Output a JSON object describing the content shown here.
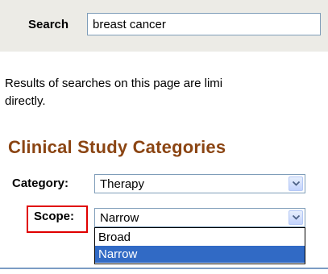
{
  "search": {
    "label": "Search",
    "value": "breast cancer"
  },
  "notice": {
    "line1": "Results of searches on this page are limi",
    "line2": "directly."
  },
  "section": {
    "title": "Clinical Study Categories"
  },
  "category": {
    "label": "Category:",
    "selected": "Therapy"
  },
  "scope": {
    "label": "Scope:",
    "selected": "Narrow",
    "options": [
      "Broad",
      "Narrow"
    ],
    "highlighted": "Narrow"
  },
  "colors": {
    "heading": "#8b4513",
    "highlight": "#316ac5",
    "focus_box": "#e00000"
  },
  "icons": [
    "chevron-down-icon"
  ]
}
